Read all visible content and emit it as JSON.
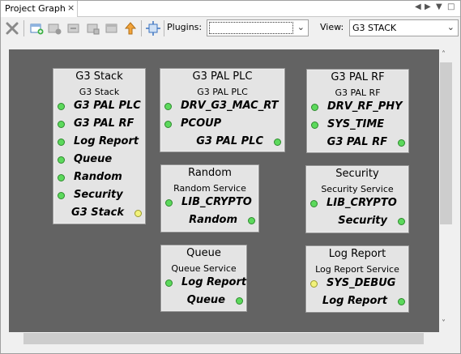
{
  "tab": {
    "title": "Project Graph",
    "close": "×"
  },
  "tab_controls": {
    "prev": "◀",
    "next": "▶",
    "menu": "▼",
    "restore": "□"
  },
  "toolbar": {
    "plugins_label": "Plugins:",
    "plugins_value": "",
    "view_label": "View:",
    "view_value": "G3 STACK",
    "dropdown_arrow": "⌄"
  },
  "scroll": {
    "up": "˄",
    "down": "˅"
  },
  "colors": {
    "canvas": "#636363",
    "node": "#e4e4e4",
    "port_green": "#5cd95c",
    "port_yellow": "#f2f27a"
  },
  "nodes": [
    {
      "title": "G3 Stack",
      "subtitle": "G3 Stack",
      "inputs": [
        {
          "label": "G3 PAL PLC",
          "color": "green"
        },
        {
          "label": "G3 PAL RF",
          "color": "green"
        },
        {
          "label": "Log Report",
          "color": "green"
        },
        {
          "label": "Queue",
          "color": "green"
        },
        {
          "label": "Random",
          "color": "green"
        },
        {
          "label": "Security",
          "color": "green"
        }
      ],
      "output": {
        "label": "G3 Stack",
        "color": "yellow"
      }
    },
    {
      "title": "G3 PAL PLC",
      "subtitle": "G3 PAL PLC",
      "inputs": [
        {
          "label": "DRV_G3_MAC_RT",
          "color": "green"
        },
        {
          "label": "PCOUP",
          "color": "green"
        }
      ],
      "output": {
        "label": "G3 PAL PLC",
        "color": "green"
      }
    },
    {
      "title": "G3 PAL RF",
      "subtitle": "G3 PAL RF",
      "inputs": [
        {
          "label": "DRV_RF_PHY",
          "color": "green"
        },
        {
          "label": "SYS_TIME",
          "color": "green"
        }
      ],
      "output": {
        "label": "G3 PAL RF",
        "color": "green"
      }
    },
    {
      "title": "Random",
      "subtitle": "Random Service",
      "inputs": [
        {
          "label": "LIB_CRYPTO",
          "color": "green"
        }
      ],
      "output": {
        "label": "Random",
        "color": "green"
      }
    },
    {
      "title": "Security",
      "subtitle": "Security Service",
      "inputs": [
        {
          "label": "LIB_CRYPTO",
          "color": "green"
        }
      ],
      "output": {
        "label": "Security",
        "color": "green"
      }
    },
    {
      "title": "Queue",
      "subtitle": "Queue Service",
      "inputs": [
        {
          "label": "Log Report",
          "color": "green"
        }
      ],
      "output": {
        "label": "Queue",
        "color": "green"
      }
    },
    {
      "title": "Log Report",
      "subtitle": "Log Report Service",
      "inputs": [
        {
          "label": "SYS_DEBUG",
          "color": "yellow"
        }
      ],
      "output": {
        "label": "Log Report",
        "color": "green"
      }
    }
  ]
}
